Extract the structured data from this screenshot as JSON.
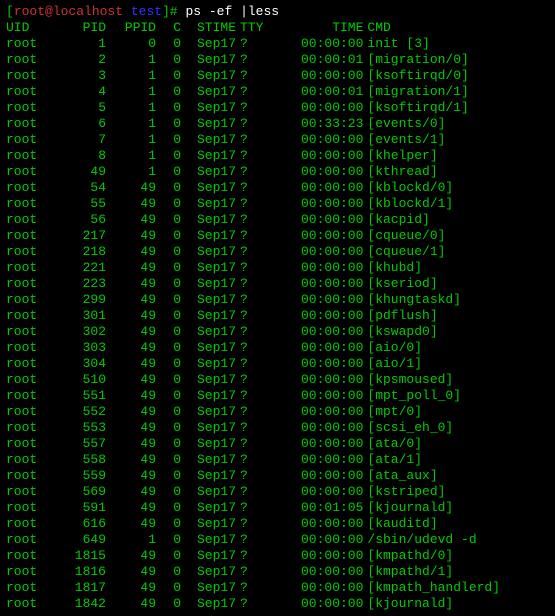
{
  "prompt": {
    "user_host": "root@localhost",
    "cwd": "test",
    "command": "ps -ef |less"
  },
  "headers": {
    "uid": "UID",
    "pid": "PID",
    "ppid": "PPID",
    "c": "C",
    "stime": "STIME",
    "tty": "TTY",
    "time": "TIME",
    "cmd": "CMD"
  },
  "rows": [
    {
      "uid": "root",
      "pid": "1",
      "ppid": "0",
      "c": "0",
      "stime": "Sep17",
      "tty": "?",
      "time": "00:00:00",
      "cmd": "init [3]"
    },
    {
      "uid": "root",
      "pid": "2",
      "ppid": "1",
      "c": "0",
      "stime": "Sep17",
      "tty": "?",
      "time": "00:00:01",
      "cmd": "[migration/0]"
    },
    {
      "uid": "root",
      "pid": "3",
      "ppid": "1",
      "c": "0",
      "stime": "Sep17",
      "tty": "?",
      "time": "00:00:00",
      "cmd": "[ksoftirqd/0]"
    },
    {
      "uid": "root",
      "pid": "4",
      "ppid": "1",
      "c": "0",
      "stime": "Sep17",
      "tty": "?",
      "time": "00:00:01",
      "cmd": "[migration/1]"
    },
    {
      "uid": "root",
      "pid": "5",
      "ppid": "1",
      "c": "0",
      "stime": "Sep17",
      "tty": "?",
      "time": "00:00:00",
      "cmd": "[ksoftirqd/1]"
    },
    {
      "uid": "root",
      "pid": "6",
      "ppid": "1",
      "c": "0",
      "stime": "Sep17",
      "tty": "?",
      "time": "00:33:23",
      "cmd": "[events/0]"
    },
    {
      "uid": "root",
      "pid": "7",
      "ppid": "1",
      "c": "0",
      "stime": "Sep17",
      "tty": "?",
      "time": "00:00:00",
      "cmd": "[events/1]"
    },
    {
      "uid": "root",
      "pid": "8",
      "ppid": "1",
      "c": "0",
      "stime": "Sep17",
      "tty": "?",
      "time": "00:00:00",
      "cmd": "[khelper]"
    },
    {
      "uid": "root",
      "pid": "49",
      "ppid": "1",
      "c": "0",
      "stime": "Sep17",
      "tty": "?",
      "time": "00:00:00",
      "cmd": "[kthread]"
    },
    {
      "uid": "root",
      "pid": "54",
      "ppid": "49",
      "c": "0",
      "stime": "Sep17",
      "tty": "?",
      "time": "00:00:00",
      "cmd": "[kblockd/0]"
    },
    {
      "uid": "root",
      "pid": "55",
      "ppid": "49",
      "c": "0",
      "stime": "Sep17",
      "tty": "?",
      "time": "00:00:00",
      "cmd": "[kblockd/1]"
    },
    {
      "uid": "root",
      "pid": "56",
      "ppid": "49",
      "c": "0",
      "stime": "Sep17",
      "tty": "?",
      "time": "00:00:00",
      "cmd": "[kacpid]"
    },
    {
      "uid": "root",
      "pid": "217",
      "ppid": "49",
      "c": "0",
      "stime": "Sep17",
      "tty": "?",
      "time": "00:00:00",
      "cmd": "[cqueue/0]"
    },
    {
      "uid": "root",
      "pid": "218",
      "ppid": "49",
      "c": "0",
      "stime": "Sep17",
      "tty": "?",
      "time": "00:00:00",
      "cmd": "[cqueue/1]"
    },
    {
      "uid": "root",
      "pid": "221",
      "ppid": "49",
      "c": "0",
      "stime": "Sep17",
      "tty": "?",
      "time": "00:00:00",
      "cmd": "[khubd]"
    },
    {
      "uid": "root",
      "pid": "223",
      "ppid": "49",
      "c": "0",
      "stime": "Sep17",
      "tty": "?",
      "time": "00:00:00",
      "cmd": "[kseriod]"
    },
    {
      "uid": "root",
      "pid": "299",
      "ppid": "49",
      "c": "0",
      "stime": "Sep17",
      "tty": "?",
      "time": "00:00:00",
      "cmd": "[khungtaskd]"
    },
    {
      "uid": "root",
      "pid": "301",
      "ppid": "49",
      "c": "0",
      "stime": "Sep17",
      "tty": "?",
      "time": "00:00:00",
      "cmd": "[pdflush]"
    },
    {
      "uid": "root",
      "pid": "302",
      "ppid": "49",
      "c": "0",
      "stime": "Sep17",
      "tty": "?",
      "time": "00:00:00",
      "cmd": "[kswapd0]"
    },
    {
      "uid": "root",
      "pid": "303",
      "ppid": "49",
      "c": "0",
      "stime": "Sep17",
      "tty": "?",
      "time": "00:00:00",
      "cmd": "[aio/0]"
    },
    {
      "uid": "root",
      "pid": "304",
      "ppid": "49",
      "c": "0",
      "stime": "Sep17",
      "tty": "?",
      "time": "00:00:00",
      "cmd": "[aio/1]"
    },
    {
      "uid": "root",
      "pid": "510",
      "ppid": "49",
      "c": "0",
      "stime": "Sep17",
      "tty": "?",
      "time": "00:00:00",
      "cmd": "[kpsmoused]"
    },
    {
      "uid": "root",
      "pid": "551",
      "ppid": "49",
      "c": "0",
      "stime": "Sep17",
      "tty": "?",
      "time": "00:00:00",
      "cmd": "[mpt_poll_0]"
    },
    {
      "uid": "root",
      "pid": "552",
      "ppid": "49",
      "c": "0",
      "stime": "Sep17",
      "tty": "?",
      "time": "00:00:00",
      "cmd": "[mpt/0]"
    },
    {
      "uid": "root",
      "pid": "553",
      "ppid": "49",
      "c": "0",
      "stime": "Sep17",
      "tty": "?",
      "time": "00:00:00",
      "cmd": "[scsi_eh_0]"
    },
    {
      "uid": "root",
      "pid": "557",
      "ppid": "49",
      "c": "0",
      "stime": "Sep17",
      "tty": "?",
      "time": "00:00:00",
      "cmd": "[ata/0]"
    },
    {
      "uid": "root",
      "pid": "558",
      "ppid": "49",
      "c": "0",
      "stime": "Sep17",
      "tty": "?",
      "time": "00:00:00",
      "cmd": "[ata/1]"
    },
    {
      "uid": "root",
      "pid": "559",
      "ppid": "49",
      "c": "0",
      "stime": "Sep17",
      "tty": "?",
      "time": "00:00:00",
      "cmd": "[ata_aux]"
    },
    {
      "uid": "root",
      "pid": "569",
      "ppid": "49",
      "c": "0",
      "stime": "Sep17",
      "tty": "?",
      "time": "00:00:00",
      "cmd": "[kstriped]"
    },
    {
      "uid": "root",
      "pid": "591",
      "ppid": "49",
      "c": "0",
      "stime": "Sep17",
      "tty": "?",
      "time": "00:01:05",
      "cmd": "[kjournald]"
    },
    {
      "uid": "root",
      "pid": "616",
      "ppid": "49",
      "c": "0",
      "stime": "Sep17",
      "tty": "?",
      "time": "00:00:00",
      "cmd": "[kauditd]"
    },
    {
      "uid": "root",
      "pid": "649",
      "ppid": "1",
      "c": "0",
      "stime": "Sep17",
      "tty": "?",
      "time": "00:00:00",
      "cmd": "/sbin/udevd -d"
    },
    {
      "uid": "root",
      "pid": "1815",
      "ppid": "49",
      "c": "0",
      "stime": "Sep17",
      "tty": "?",
      "time": "00:00:00",
      "cmd": "[kmpathd/0]"
    },
    {
      "uid": "root",
      "pid": "1816",
      "ppid": "49",
      "c": "0",
      "stime": "Sep17",
      "tty": "?",
      "time": "00:00:00",
      "cmd": "[kmpathd/1]"
    },
    {
      "uid": "root",
      "pid": "1817",
      "ppid": "49",
      "c": "0",
      "stime": "Sep17",
      "tty": "?",
      "time": "00:00:00",
      "cmd": "[kmpath_handlerd]"
    },
    {
      "uid": "root",
      "pid": "1842",
      "ppid": "49",
      "c": "0",
      "stime": "Sep17",
      "tty": "?",
      "time": "00:00:00",
      "cmd": "[kjournald]"
    }
  ]
}
